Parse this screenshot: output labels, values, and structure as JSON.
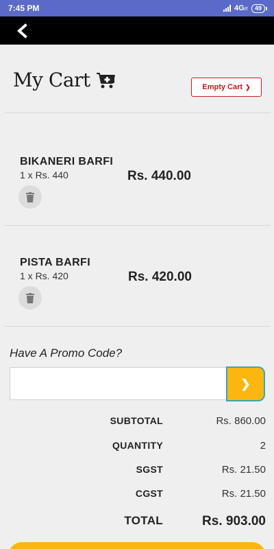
{
  "status_bar": {
    "time": "7:45 PM",
    "network": "4G",
    "network_sub": "iT",
    "battery": "49"
  },
  "app_bar": {
    "back_icon": "chevron-left-icon"
  },
  "header": {
    "title": "My Cart",
    "cart_icon": "cart-plus-icon",
    "empty_cart_label": "Empty Cart",
    "empty_cart_chevron": "❯"
  },
  "items": [
    {
      "name": "BIKANERI BARFI",
      "quantity_line": "1 x Rs. 440",
      "price": "Rs. 440.00"
    },
    {
      "name": "PISTA BARFI",
      "quantity_line": "1 x Rs. 420",
      "price": "Rs. 420.00"
    }
  ],
  "promo": {
    "label": "Have A Promo Code?",
    "value": "",
    "apply_label": "❯"
  },
  "summary": {
    "subtotal_label": "SUBTOTAL",
    "subtotal_value": "Rs. 860.00",
    "quantity_label": "QUANTITY",
    "quantity_value": "2",
    "sgst_label": "SGST",
    "sgst_value": "Rs. 21.50",
    "cgst_label": "CGST",
    "cgst_value": "Rs. 21.50",
    "total_label": "TOTAL",
    "total_value": "Rs. 903.00"
  },
  "colors": {
    "status_bar": "#5b6ac8",
    "accent": "#fbb70f",
    "danger": "#cc1414",
    "background": "#efefef"
  }
}
